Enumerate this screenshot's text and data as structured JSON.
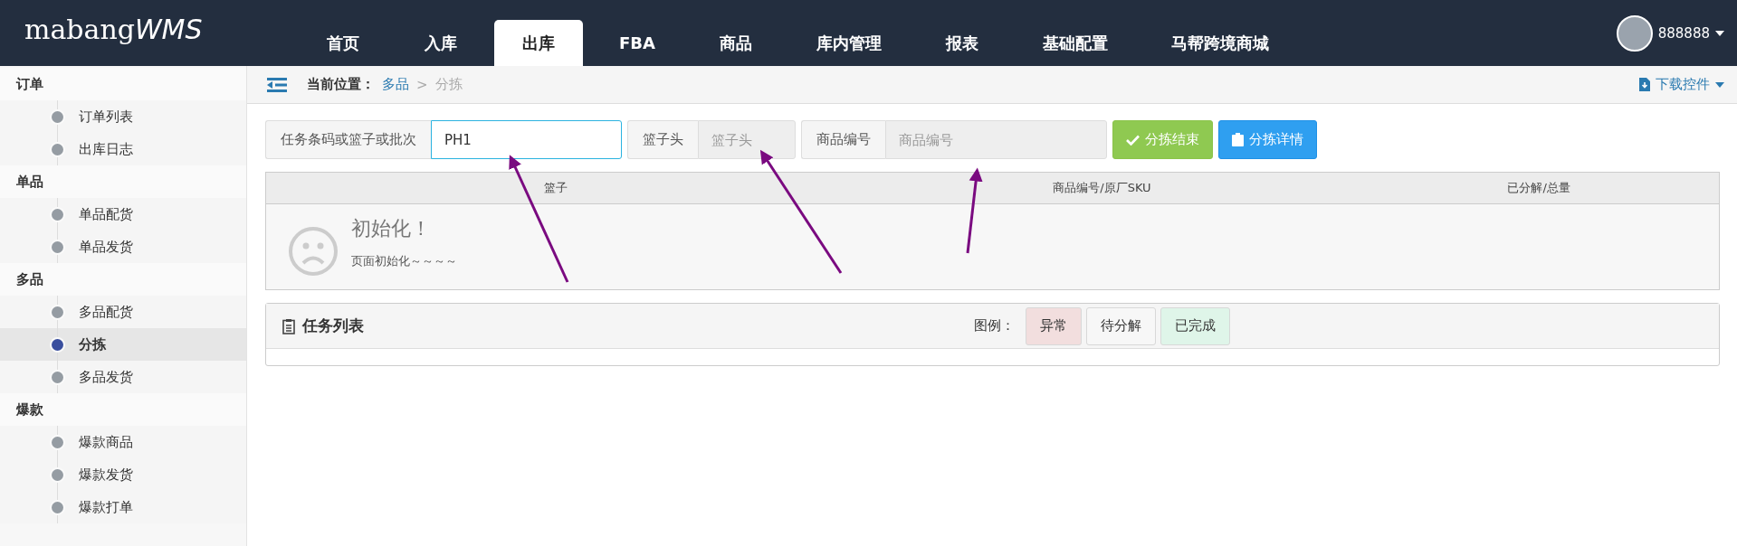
{
  "header": {
    "logo_text": "mabang",
    "logo_accent": "WMS",
    "nav": [
      {
        "label": "首页",
        "selected": false
      },
      {
        "label": "入库",
        "selected": false
      },
      {
        "label": "出库",
        "selected": true
      },
      {
        "label": "FBA",
        "selected": false
      },
      {
        "label": "商品",
        "selected": false
      },
      {
        "label": "库内管理",
        "selected": false
      },
      {
        "label": "报表",
        "selected": false
      },
      {
        "label": "基础配置",
        "selected": false
      },
      {
        "label": "马帮跨境商城",
        "selected": false
      }
    ],
    "user": "888888"
  },
  "sidebar": {
    "groups": [
      {
        "label": "订单",
        "children": [
          {
            "label": "订单列表",
            "selected": false
          },
          {
            "label": "出库日志",
            "selected": false
          }
        ]
      },
      {
        "label": "单品",
        "children": [
          {
            "label": "单品配货",
            "selected": false
          },
          {
            "label": "单品发货",
            "selected": false
          }
        ]
      },
      {
        "label": "多品",
        "children": [
          {
            "label": "多品配货",
            "selected": false
          },
          {
            "label": "分拣",
            "selected": true
          },
          {
            "label": "多品发货",
            "selected": false
          }
        ]
      },
      {
        "label": "爆款",
        "children": [
          {
            "label": "爆款商品",
            "selected": false
          },
          {
            "label": "爆款发货",
            "selected": false
          },
          {
            "label": "爆款打单",
            "selected": false
          }
        ]
      }
    ]
  },
  "breadcrumb": {
    "label": "当前位置：",
    "parent": "多品",
    "separator": ">",
    "current": "分拣",
    "download": "下载控件"
  },
  "form": {
    "fields": [
      {
        "label": "任务条码或篮子或批次",
        "value": "PH1",
        "focused": true
      },
      {
        "label": "篮子头",
        "placeholder": "篮子头",
        "focused": false
      },
      {
        "label": "商品编号",
        "placeholder": "商品编号",
        "focused": false
      }
    ],
    "buttons": [
      {
        "kind": "success",
        "label": "分拣结束"
      },
      {
        "kind": "primary",
        "label": "分拣详情"
      }
    ]
  },
  "table": {
    "columns": [
      "篮子",
      "商品编号/原厂SKU",
      "已分解/总量"
    ],
    "empty_title": "初始化！",
    "empty_text": "页面初始化～～～～"
  },
  "task_panel": {
    "title": "任务列表",
    "legend_label": "图例：",
    "legend": [
      {
        "label": "异常",
        "color": "#f2dede"
      },
      {
        "label": "待分解",
        "color": "#f7f7f7"
      },
      {
        "label": "已完成",
        "color": "#dff5e9"
      }
    ]
  }
}
